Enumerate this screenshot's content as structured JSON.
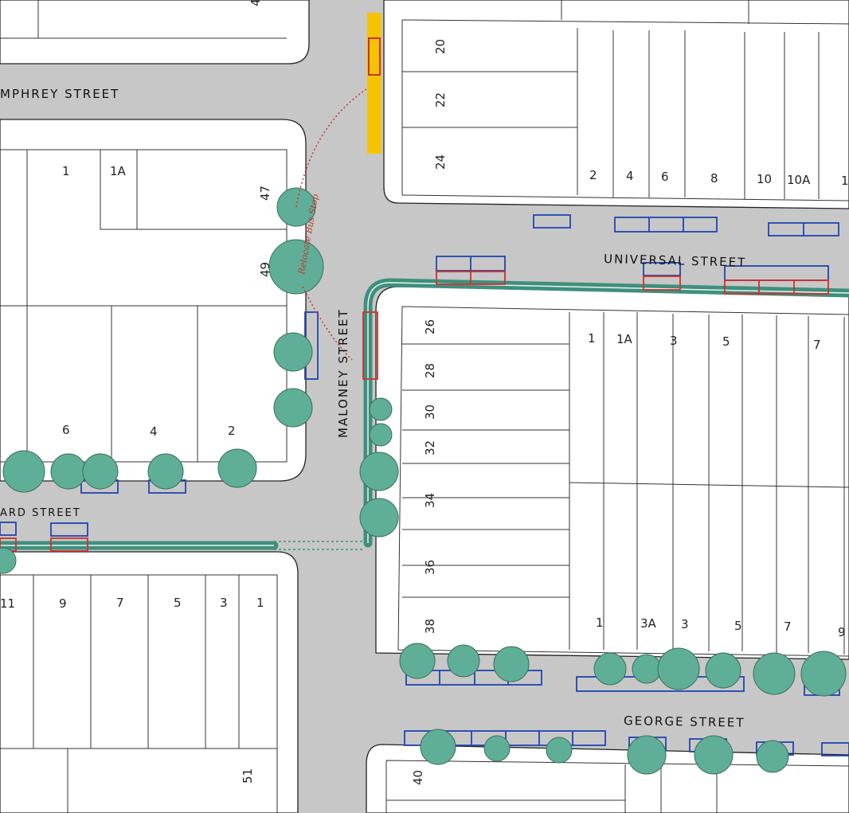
{
  "streets": {
    "humphrey": "MPHREY STREET",
    "universal": "UNIVERSAL STREET",
    "maloney": "MALONEY STREET",
    "george": "GEORGE STREET",
    "ward": "ARD STREET"
  },
  "annotation": "Relocate Bus Stop",
  "lot_numbers": {
    "top_left_partial": "4",
    "block_nw": [
      "1",
      "1A",
      "47",
      "49",
      "6",
      "4",
      "2"
    ],
    "block_ne_vertical": [
      "20",
      "22",
      "24"
    ],
    "block_ne_bottom": [
      "2",
      "4",
      "6",
      "8",
      "10",
      "10A",
      "1"
    ],
    "block_e_vertical": [
      "26",
      "28",
      "30",
      "32",
      "34",
      "36",
      "38"
    ],
    "block_e_top": [
      "1",
      "1A",
      "3",
      "5",
      "7"
    ],
    "block_e_bottom": [
      "1",
      "3A",
      "3",
      "5",
      "7",
      "9"
    ],
    "block_sw": [
      "11",
      "9",
      "7",
      "5",
      "3",
      "1",
      "51"
    ],
    "block_se": [
      "40"
    ]
  },
  "colors": {
    "road": "#c9c9c9",
    "cycleway": "#3f8f7e",
    "parking_blue": "#1f45b0",
    "parking_red": "#d0302a",
    "bus_stop": "#f5c400",
    "tree": "#5fae98"
  }
}
